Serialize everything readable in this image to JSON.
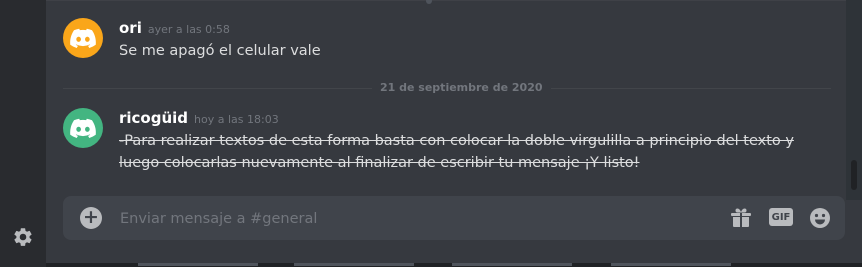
{
  "colors": {
    "background": "#36393f",
    "rail": "#292b2f",
    "composer": "#40444b",
    "avatar_ori": "#faa61a",
    "avatar_ricoguid": "#43b581",
    "text": "#dcddde",
    "muted": "#72767d"
  },
  "icons": {
    "settings": "gear-icon",
    "add": "plus-circle-icon",
    "gift": "gift-icon",
    "gif": "gif-icon",
    "emoji": "smiley-icon",
    "avatar": "discord-logo-icon"
  },
  "messages": [
    {
      "username": "ori",
      "timestamp": "ayer a las 0:58",
      "text": "Se me apagó el celular vale",
      "strikethrough": false
    },
    {
      "username": "ricogüid",
      "timestamp": "hoy a las 18:03",
      "text": "-Para realizar textos de esta forma basta con colocar la doble virgulilla a principio del texto y luego colocarlas nuevamente al finalizar de escribir tu mensaje ¡Y listo!",
      "strikethrough": true
    }
  ],
  "date_divider": "21 de septiembre de 2020",
  "composer": {
    "placeholder": "Enviar mensaje a #general",
    "value": "",
    "gif_label": "GIF"
  }
}
